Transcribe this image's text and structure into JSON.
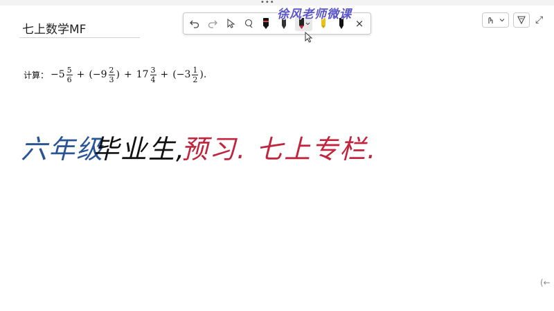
{
  "page": {
    "title": "七上数学MF"
  },
  "watermark": "徐风老师微课",
  "problem": {
    "label": "计算：",
    "t1_sign": "−5",
    "t1_num": "5",
    "t1_den": "6",
    "op1": "+",
    "t2_open": "(−9",
    "t2_num": "2",
    "t2_den": "3",
    "t2_close": ")",
    "op2": "+",
    "t3_whole": "17",
    "t3_num": "3",
    "t3_den": "4",
    "op3": "+",
    "t4_open": "(−3",
    "t4_num": "1",
    "t4_den": "2",
    "t4_close": ")."
  },
  "handwriting": {
    "part1": "六年级",
    "part2": "毕业生,",
    "part3": "预习. 七上专栏."
  },
  "colors": {
    "ink_blue": "#2a5595",
    "ink_black": "#111111",
    "ink_red": "#c0253d",
    "watermark": "#5a55c6"
  },
  "toolbar": {
    "tools": [
      "undo-icon",
      "redo-icon",
      "select-icon",
      "lasso-icon",
      "pen-black-icon",
      "pen-dark-icon",
      "pen-red-icon",
      "highlighter-yellow-icon",
      "pen-black-small-icon",
      "close-icon"
    ],
    "close_label": "×"
  },
  "right_tools": {
    "expand_label": "⤢"
  },
  "edge_mark": "(←"
}
